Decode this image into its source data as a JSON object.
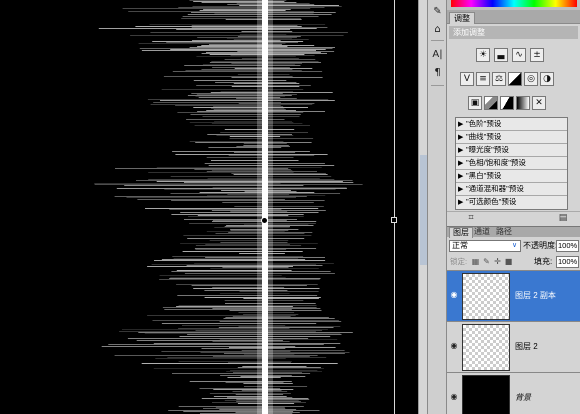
{
  "colors": {
    "selection": "#3a78d0",
    "panel_bg": "#d4d4d4",
    "canvas_bg": "#000000"
  },
  "adjustments": {
    "tabs": [
      "调整"
    ],
    "title": "添加调整",
    "icons_row1": [
      "brightness-contrast-icon",
      "levels-icon",
      "curves-icon",
      "exposure-icon"
    ],
    "icons_row2": [
      "vibrance-icon",
      "hue-saturation-icon",
      "color-balance-icon",
      "black-white-icon",
      "photo-filter-icon",
      "channel-mixer-icon"
    ],
    "icons_row3": [
      "invert-icon",
      "posterize-icon",
      "threshold-icon",
      "gradient-map-icon",
      "selective-color-icon"
    ],
    "presets": [
      "\"色阶\"预设",
      "\"曲线\"预设",
      "\"曝光度\"预设",
      "\"色相/饱和度\"预设",
      "\"黑白\"预设",
      "\"通道混和器\"预设",
      "\"可选颜色\"预设"
    ]
  },
  "layers_panel": {
    "tabs": [
      "图层",
      "通道",
      "路径"
    ],
    "blend_mode": "正常",
    "opacity_label": "不透明度:",
    "opacity_value": "100%",
    "lock_label": "锁定:",
    "fill_label": "填充:",
    "fill_value": "100%",
    "layers": [
      {
        "name": "图层 2 副本",
        "selected": true,
        "thumb": "transparent"
      },
      {
        "name": "图层 2",
        "selected": false,
        "thumb": "transparent"
      },
      {
        "name": "背景",
        "selected": false,
        "thumb": "black"
      }
    ]
  },
  "toolstrip": {
    "icons": [
      "history-brush-icon",
      "stamp-icon",
      "character-icon",
      "paragraph-icon"
    ],
    "labels": [
      "A|",
      "¶"
    ]
  }
}
